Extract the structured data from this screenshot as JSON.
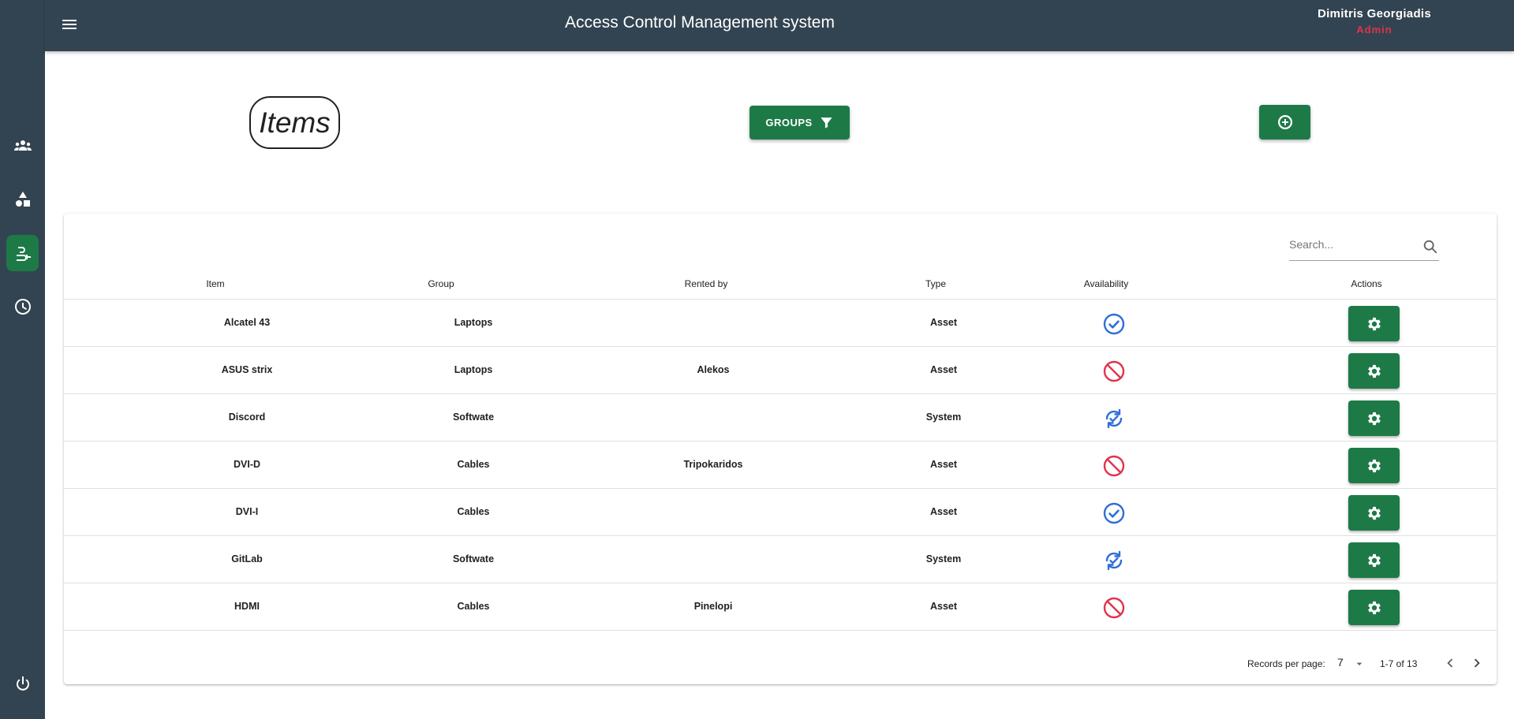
{
  "app": {
    "title": "Access Control Management system"
  },
  "user": {
    "name": "Dimitris Georgiadis",
    "role": "Admin"
  },
  "sidebar": {
    "items": [
      {
        "icon": "people-icon",
        "active": false
      },
      {
        "icon": "shapes-icon",
        "active": false
      },
      {
        "icon": "items-icon",
        "active": true
      },
      {
        "icon": "clock-icon",
        "active": false
      }
    ],
    "logout_icon": "power-icon"
  },
  "page": {
    "title": "Items",
    "groups_label": "GROUPS"
  },
  "search": {
    "placeholder": "Search..."
  },
  "table": {
    "headers": [
      "Item",
      "Group",
      "Rented by",
      "Type",
      "Availability",
      "Actions"
    ],
    "rows": [
      {
        "item": "Alcatel 43",
        "group": "Laptops",
        "rented_by": "",
        "type": "Asset",
        "availability": "available"
      },
      {
        "item": "ASUS strix",
        "group": "Laptops",
        "rented_by": "Alekos",
        "type": "Asset",
        "availability": "unavailable"
      },
      {
        "item": "Discord",
        "group": "Softwate",
        "rented_by": "",
        "type": "System",
        "availability": "system"
      },
      {
        "item": "DVI-D",
        "group": "Cables",
        "rented_by": "Tripokaridos",
        "type": "Asset",
        "availability": "unavailable"
      },
      {
        "item": "DVI-I",
        "group": "Cables",
        "rented_by": "",
        "type": "Asset",
        "availability": "available"
      },
      {
        "item": "GitLab",
        "group": "Softwate",
        "rented_by": "",
        "type": "System",
        "availability": "system"
      },
      {
        "item": "HDMI",
        "group": "Cables",
        "rented_by": "Pinelopi",
        "type": "Asset",
        "availability": "unavailable"
      }
    ]
  },
  "pagination": {
    "records_per_page_label": "Records per page:",
    "records_per_page": "7",
    "range": "1-7 of 13"
  },
  "colors": {
    "sidebar_bg": "#324451",
    "accent_green": "#1d7a47",
    "available_blue": "#2f6fd6",
    "unavailable_red": "#e0334b",
    "role_red": "#e0334b"
  }
}
